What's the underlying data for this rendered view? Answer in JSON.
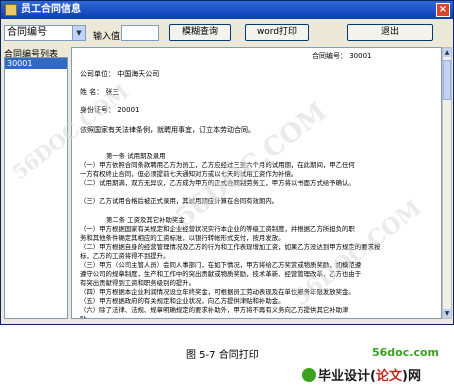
{
  "window": {
    "title": "员工合同信息",
    "close_glyph": "×"
  },
  "toolbar": {
    "field_select": "合同编号",
    "input_label": "输入值",
    "search_button": "模糊查询",
    "print_button": "word打印",
    "exit_button": "退出"
  },
  "sidebar": {
    "header": "合同编号列表",
    "items": [
      "30001"
    ]
  },
  "document": {
    "contract_number": "合同编号：    30001",
    "company": "公司单位：   中国海天公司",
    "name": "姓    名：   张三",
    "id_number": "身份证号：   20001",
    "intro": "依照国家有关法律条例，就聘用事宜，订立本劳动合同。",
    "section1_title": "第一条  试用期及录用",
    "section1_lines": [
      "（一）甲方依照合同条款聘用乙方为员工，乙方应经过三至六个月的试用期，在此期间，甲乙任何",
      "一方有权终止合同，但必须提前七天通知对方或以七天的试用工资作为补偿。",
      "（二）试用期满，双方无异议，乙方成为甲方的正式合同制劳务工，甲方将以书面方式给予确认。",
      "",
      "（三）乙方试用合格后被正式录用，其试用期应计算在合同有效期内。"
    ],
    "section2_title": "第二条  工资及其它补助奖金",
    "section2_lines": [
      "（一）甲方根据国家有关规定和企业经营状况实行本企业的等级工资制度，并根据乙方所担负的职",
      "务和其他条件确定其相应的工资标准，以银行转帐形式支付，按月发放。",
      "（二）甲方根据自身的经营管理情况及乙方的行为和工作表现增加工资，如果乙方没达到甲方规定的要求按",
      "标，乙方的工资将得不到提升。",
      "（三）甲方（公司主管人员）会同人事部门，在如下情况，甲方将给乙方奖赏或物质奖励，如模范遵",
      "遵守公司的规章制度，生产和工作中的突出贡献或物质奖励，技术革新、经营管理改革，乙方也由于",
      "有突出贡献得到工资和职务级别的提升。",
      "（四）甲方根据本企业利润情况设立年终奖金，可根据员工劳动表现及在单位服务年限发放奖金。",
      "（五）甲方根据政府的有关规定和企业状况，向乙方提供津贴和补助金。",
      "（六）除了法律、法规、规章明确规定的要求补助外，甲方将不再有义务向乙方提供其它补助津",
      "贴。"
    ]
  },
  "scrollbar": {
    "up_glyph": "▲",
    "down_glyph": "▼"
  },
  "caption": "图 5-7    合同打印",
  "watermarks": [
    "56DOC.COM",
    "56DOC.COM",
    "56DOC.COM"
  ],
  "brand": {
    "site": "56doc.com",
    "prefix": "毕业设计",
    "paren_open": "(",
    "middle": "论文",
    "paren_close": ")",
    "suffix": "网"
  },
  "colors": {
    "titlebar": "#0b3fb5",
    "selection": "#316ac5",
    "brand_green": "#3aa11a",
    "brand_red": "#c0281c"
  }
}
